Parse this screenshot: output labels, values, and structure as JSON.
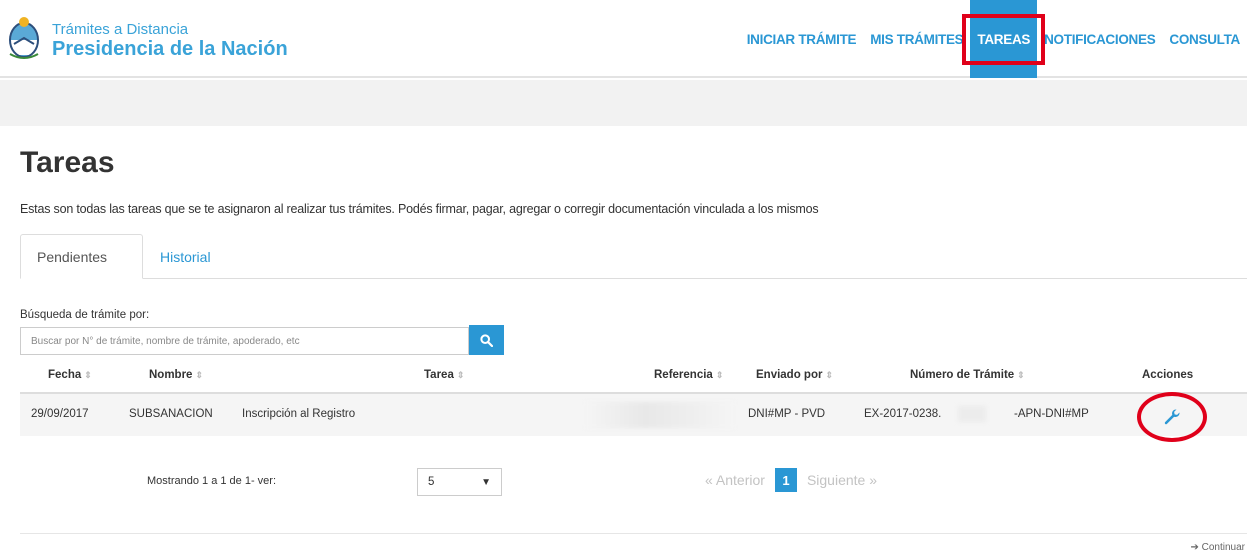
{
  "brand": {
    "line1": "Trámites a Distancia",
    "line2": "Presidencia de la Nación"
  },
  "nav": {
    "items": [
      {
        "label": "INICIAR TRÁMITE"
      },
      {
        "label": "MIS TRÁMITES"
      },
      {
        "label": "TAREAS"
      },
      {
        "label": "NOTIFICACIONES"
      },
      {
        "label": "CONSULTA"
      }
    ],
    "active": "TAREAS"
  },
  "page": {
    "title": "Tareas",
    "description": "Estas son todas las tareas que se te asignaron al realizar tus trámites. Podés firmar, pagar, agregar o corregir documentación vinculada a los mismos"
  },
  "tabs": [
    {
      "label": "Pendientes"
    },
    {
      "label": "Historial"
    }
  ],
  "search": {
    "label": "Búsqueda de trámite por:",
    "placeholder": "Buscar por N° de trámite, nombre de trámite, apoderado, etc"
  },
  "table": {
    "headers": {
      "fecha": "Fecha",
      "nombre": "Nombre",
      "tarea": "Tarea",
      "referencia": "Referencia",
      "enviado_por": "Enviado por",
      "numero": "Número de Trámite",
      "acciones": "Acciones"
    },
    "rows": [
      {
        "fecha": "29/09/2017",
        "nombre": "SUBSANACION",
        "tarea": "Inscripción al Registro",
        "enviado_por": "DNI#MP - PVD",
        "numero_a": "EX-2017-0238.",
        "numero_b": "-APN-DNI#MP"
      }
    ]
  },
  "footer": {
    "showing": "Mostrando 1 a 1 de 1- ver:",
    "page_size": "5",
    "prev": "« Anterior",
    "current_page": "1",
    "next": "Siguiente »",
    "continuar": "Continuar"
  },
  "colors": {
    "accent": "#2a97d4",
    "highlight": "#e0001a"
  }
}
